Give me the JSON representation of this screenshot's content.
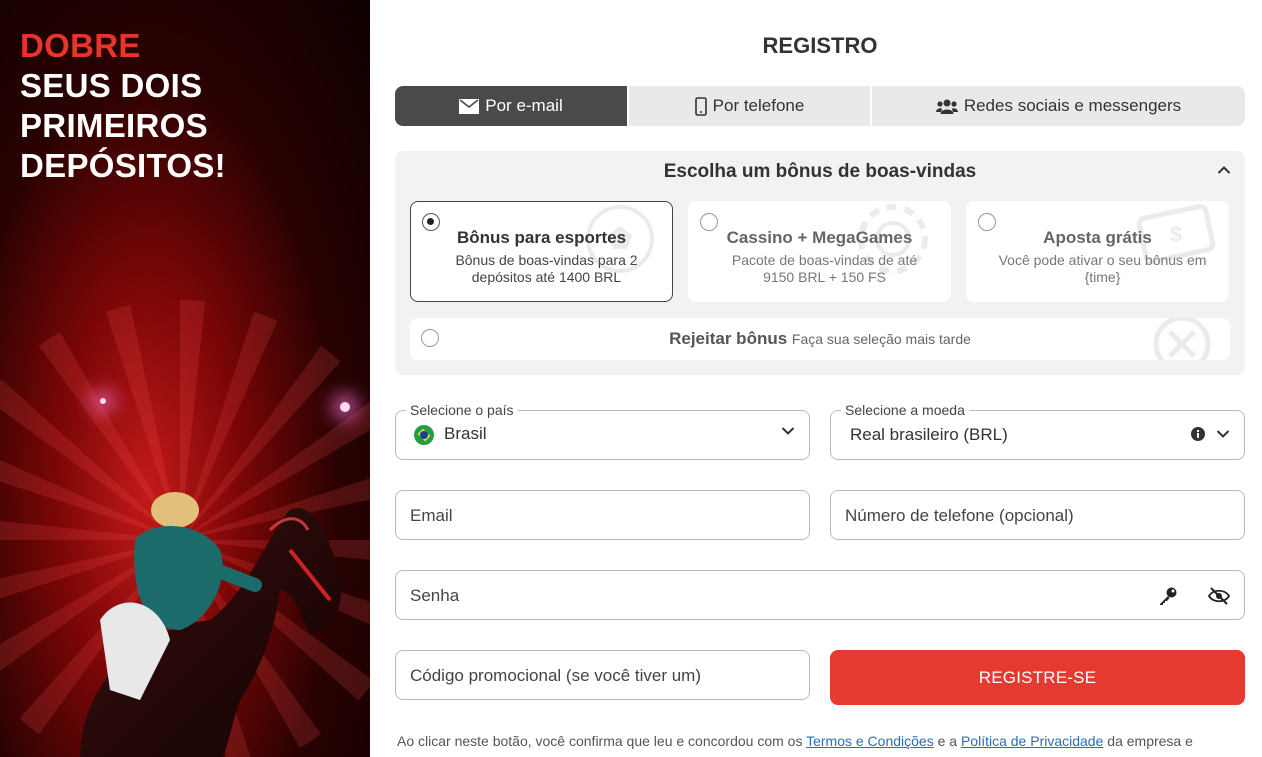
{
  "promo": {
    "headline_accent": "DOBRE",
    "headline_lines": [
      "SEUS DOIS",
      "PRIMEIROS",
      "DEPÓSITOS!"
    ]
  },
  "form": {
    "title": "REGISTRO",
    "tabs": [
      {
        "label": "Por e-mail",
        "icon": "envelope-icon",
        "active": true
      },
      {
        "label": "Por telefone",
        "icon": "phone-icon",
        "active": false
      },
      {
        "label": "Redes sociais e messengers",
        "icon": "users-icon",
        "active": false
      }
    ],
    "bonus": {
      "title": "Escolha um bônus de boas-vindas",
      "options": [
        {
          "title": "Bônus para esportes",
          "description": "Bônus de boas-vindas para 2 depósitos até 1400 BRL",
          "selected": true
        },
        {
          "title": "Cassino + MegaGames",
          "description": "Pacote de boas-vindas de até 9150 BRL + 150 FS",
          "selected": false
        },
        {
          "title": "Aposta grátis",
          "description": "Você pode ativar o seu bônus em {time}",
          "selected": false
        }
      ],
      "reject": {
        "title": "Rejeitar bônus",
        "subtitle": "Faça sua seleção mais tarde"
      }
    },
    "country": {
      "label": "Selecione o país",
      "value": "Brasil"
    },
    "currency": {
      "label": "Selecione a moeda",
      "value": "Real brasileiro (BRL)"
    },
    "email": {
      "placeholder": "Email"
    },
    "phone": {
      "placeholder": "Número de telefone (opcional)"
    },
    "password": {
      "placeholder": "Senha"
    },
    "promo_code": {
      "placeholder": "Código promocional (se você tiver um)"
    },
    "register_button": "REGISTRE-SE",
    "terms": {
      "prefix": "Ao clicar neste botão, você confirma que leu e concordou com os",
      "terms_link": "Termos e Condições",
      "middle": "e a",
      "privacy_link": "Política de Privacidade",
      "suffix": "da empresa e"
    }
  },
  "colors": {
    "accent": "#e53a30",
    "tab_active": "#4a4a4a",
    "link": "#2a6db3"
  }
}
